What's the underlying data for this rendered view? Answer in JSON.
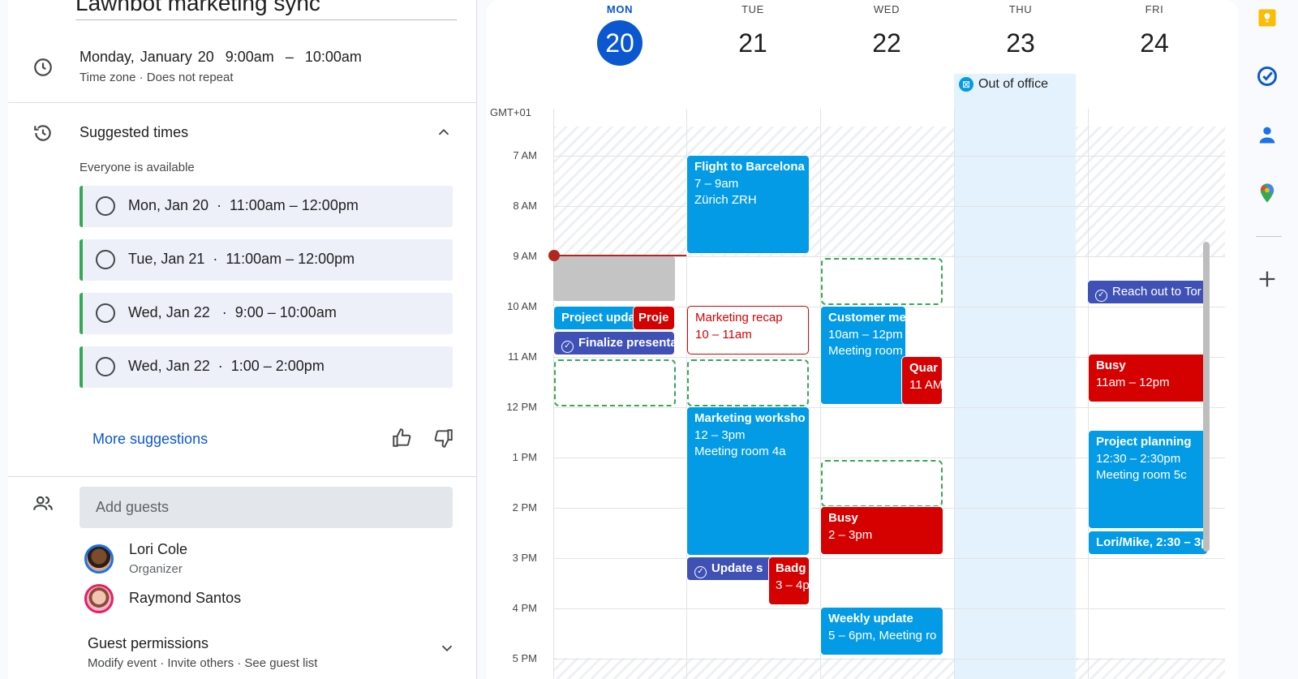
{
  "event": {
    "title": "Lawnbot marketing sync",
    "date": "Monday, January 20",
    "start": "9:00am",
    "dash": "–",
    "end": "10:00am",
    "subline": "Time zone · Does not repeat"
  },
  "suggested": {
    "title": "Suggested times",
    "subtitle": "Everyone is available",
    "slots": [
      {
        "label": "Mon, Jan 20  ·  11:00am – 12:00pm"
      },
      {
        "label": "Tue, Jan 21  ·  11:00am – 12:00pm"
      },
      {
        "label": "Wed, Jan 22   ·  9:00 – 10:00am"
      },
      {
        "label": "Wed, Jan 22  ·  1:00 – 2:00pm"
      }
    ],
    "more": "More suggestions"
  },
  "guests": {
    "placeholder": "Add guests",
    "list": [
      {
        "name": "Lori Cole",
        "role": "Organizer"
      },
      {
        "name": "Raymond Santos",
        "role": ""
      }
    ],
    "permissions_title": "Guest permissions",
    "permissions_sub": "Modify event · Invite others · See guest list"
  },
  "calendar": {
    "timezone": "GMT+01",
    "days": [
      {
        "name": "MON",
        "num": "20",
        "today": true
      },
      {
        "name": "TUE",
        "num": "21",
        "today": false
      },
      {
        "name": "WED",
        "num": "22",
        "today": false
      },
      {
        "name": "THU",
        "num": "23",
        "today": false
      },
      {
        "name": "FRI",
        "num": "24",
        "today": false
      }
    ],
    "hours": [
      "7 AM",
      "8 AM",
      "9 AM",
      "10 AM",
      "11 AM",
      "12 PM",
      "1 PM",
      "2 PM",
      "3 PM",
      "4 PM",
      "5 PM"
    ],
    "out_of_office": "Out of office",
    "events": {
      "mon_project_update": {
        "title": "Project upda"
      },
      "mon_project": {
        "title": "Proje"
      },
      "mon_finalize": {
        "title": "Finalize presenta"
      },
      "tue_flight": {
        "title": "Flight to Barcelona",
        "time": "7 – 9am",
        "place": "Zürich ZRH"
      },
      "tue_marketing_recap": {
        "title": "Marketing recap",
        "time": "10 – 11am"
      },
      "tue_workshop": {
        "title": "Marketing worksho",
        "time": "12 – 3pm",
        "place": "Meeting room 4a"
      },
      "tue_update": {
        "title": "Update s"
      },
      "tue_badge": {
        "title": "Badg",
        "time": "3 – 4p"
      },
      "wed_customer": {
        "title": "Customer me",
        "time": "10am – 12pm",
        "place": "Meeting room"
      },
      "wed_quar": {
        "title": "Quar",
        "time": "11 AM"
      },
      "wed_busy": {
        "title": "Busy",
        "time": "2 – 3pm"
      },
      "wed_weekly": {
        "title": "Weekly update",
        "time": "5 – 6pm, Meeting ro"
      },
      "fri_reach": {
        "title": "Reach out to Tor"
      },
      "fri_busy": {
        "title": "Busy",
        "time": "11am – 12pm"
      },
      "fri_planning": {
        "title": "Project planning",
        "time": "12:30 – 2:30pm",
        "place": "Meeting room 5c"
      },
      "fri_lori": {
        "title": "Lori/Mike, 2:30 – 3p"
      }
    }
  },
  "colors": {
    "primary": "#0b57d0",
    "event_blue": "#039be5",
    "event_red": "#d50000",
    "task_purple": "#3f51b5",
    "suggest_green": "#34a853",
    "ooo_bg": "#e3f2fd"
  },
  "rail": {
    "icons": [
      "keep-icon",
      "tasks-icon",
      "contacts-icon",
      "maps-icon",
      "add-icon"
    ]
  }
}
